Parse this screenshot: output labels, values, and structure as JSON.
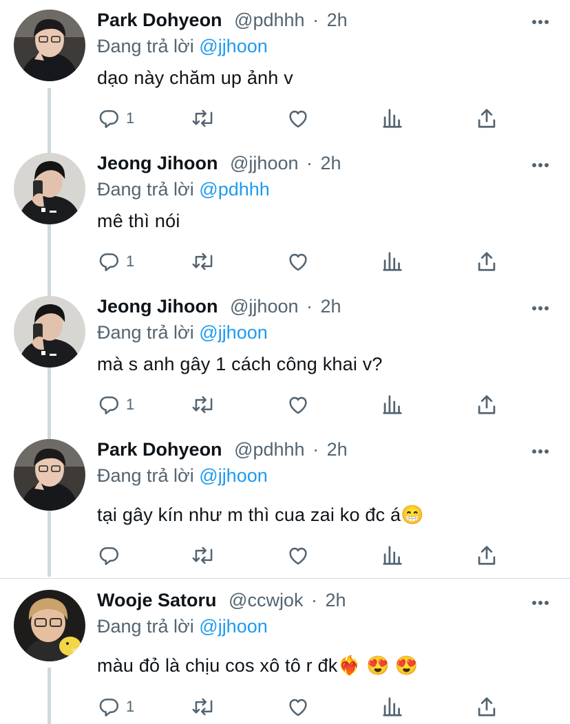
{
  "tweets": [
    {
      "name": "Park Dohyeon",
      "handle": "@pdhhh",
      "time": "2h",
      "replying_prefix": "Đang trả lời",
      "replying_to": "@jjhoon",
      "text": "dạo này chăm up ảnh v",
      "reply_count": "1",
      "avatar": "park-dohyeon"
    },
    {
      "name": "Jeong Jihoon",
      "handle": "@jjhoon",
      "time": "2h",
      "replying_prefix": "Đang trả lời",
      "replying_to": "@pdhhh",
      "text": "mê thì nói",
      "reply_count": "1",
      "avatar": "jeong-jihoon"
    },
    {
      "name": "Jeong Jihoon",
      "handle": "@jjhoon",
      "time": "2h",
      "replying_prefix": "Đang trả lời",
      "replying_to": "@jjhoon",
      "text": "mà s anh gây 1 cách công khai v?",
      "reply_count": "1",
      "avatar": "jeong-jihoon"
    },
    {
      "name": "Park Dohyeon",
      "handle": "@pdhhh",
      "time": "2h",
      "replying_prefix": "Đang trả lời",
      "replying_to": "@jjhoon",
      "text": "tại gây kín như m thì cua zai ko đc á",
      "text_emoji": "😁",
      "reply_count": "",
      "avatar": "park-dohyeon"
    },
    {
      "name": "Wooje Satoru",
      "handle": "@ccwjok",
      "time": "2h",
      "replying_prefix": "Đang trả lời",
      "replying_to": "@jjhoon",
      "text": "màu đỏ là chịu cos xô tô r đk",
      "text_emoji": "❤️‍🔥 😍 😍",
      "reply_count": "1",
      "avatar": "wooje-satoru"
    }
  ],
  "separator": "·",
  "icons": {
    "reply": "reply-icon",
    "retweet": "retweet-icon",
    "like": "heart-icon",
    "views": "views-icon",
    "share": "share-icon",
    "more": "more-icon"
  },
  "colors": {
    "mention": "#1d9bf0",
    "secondary_text": "#536471",
    "thread_line": "#cfd9de"
  }
}
